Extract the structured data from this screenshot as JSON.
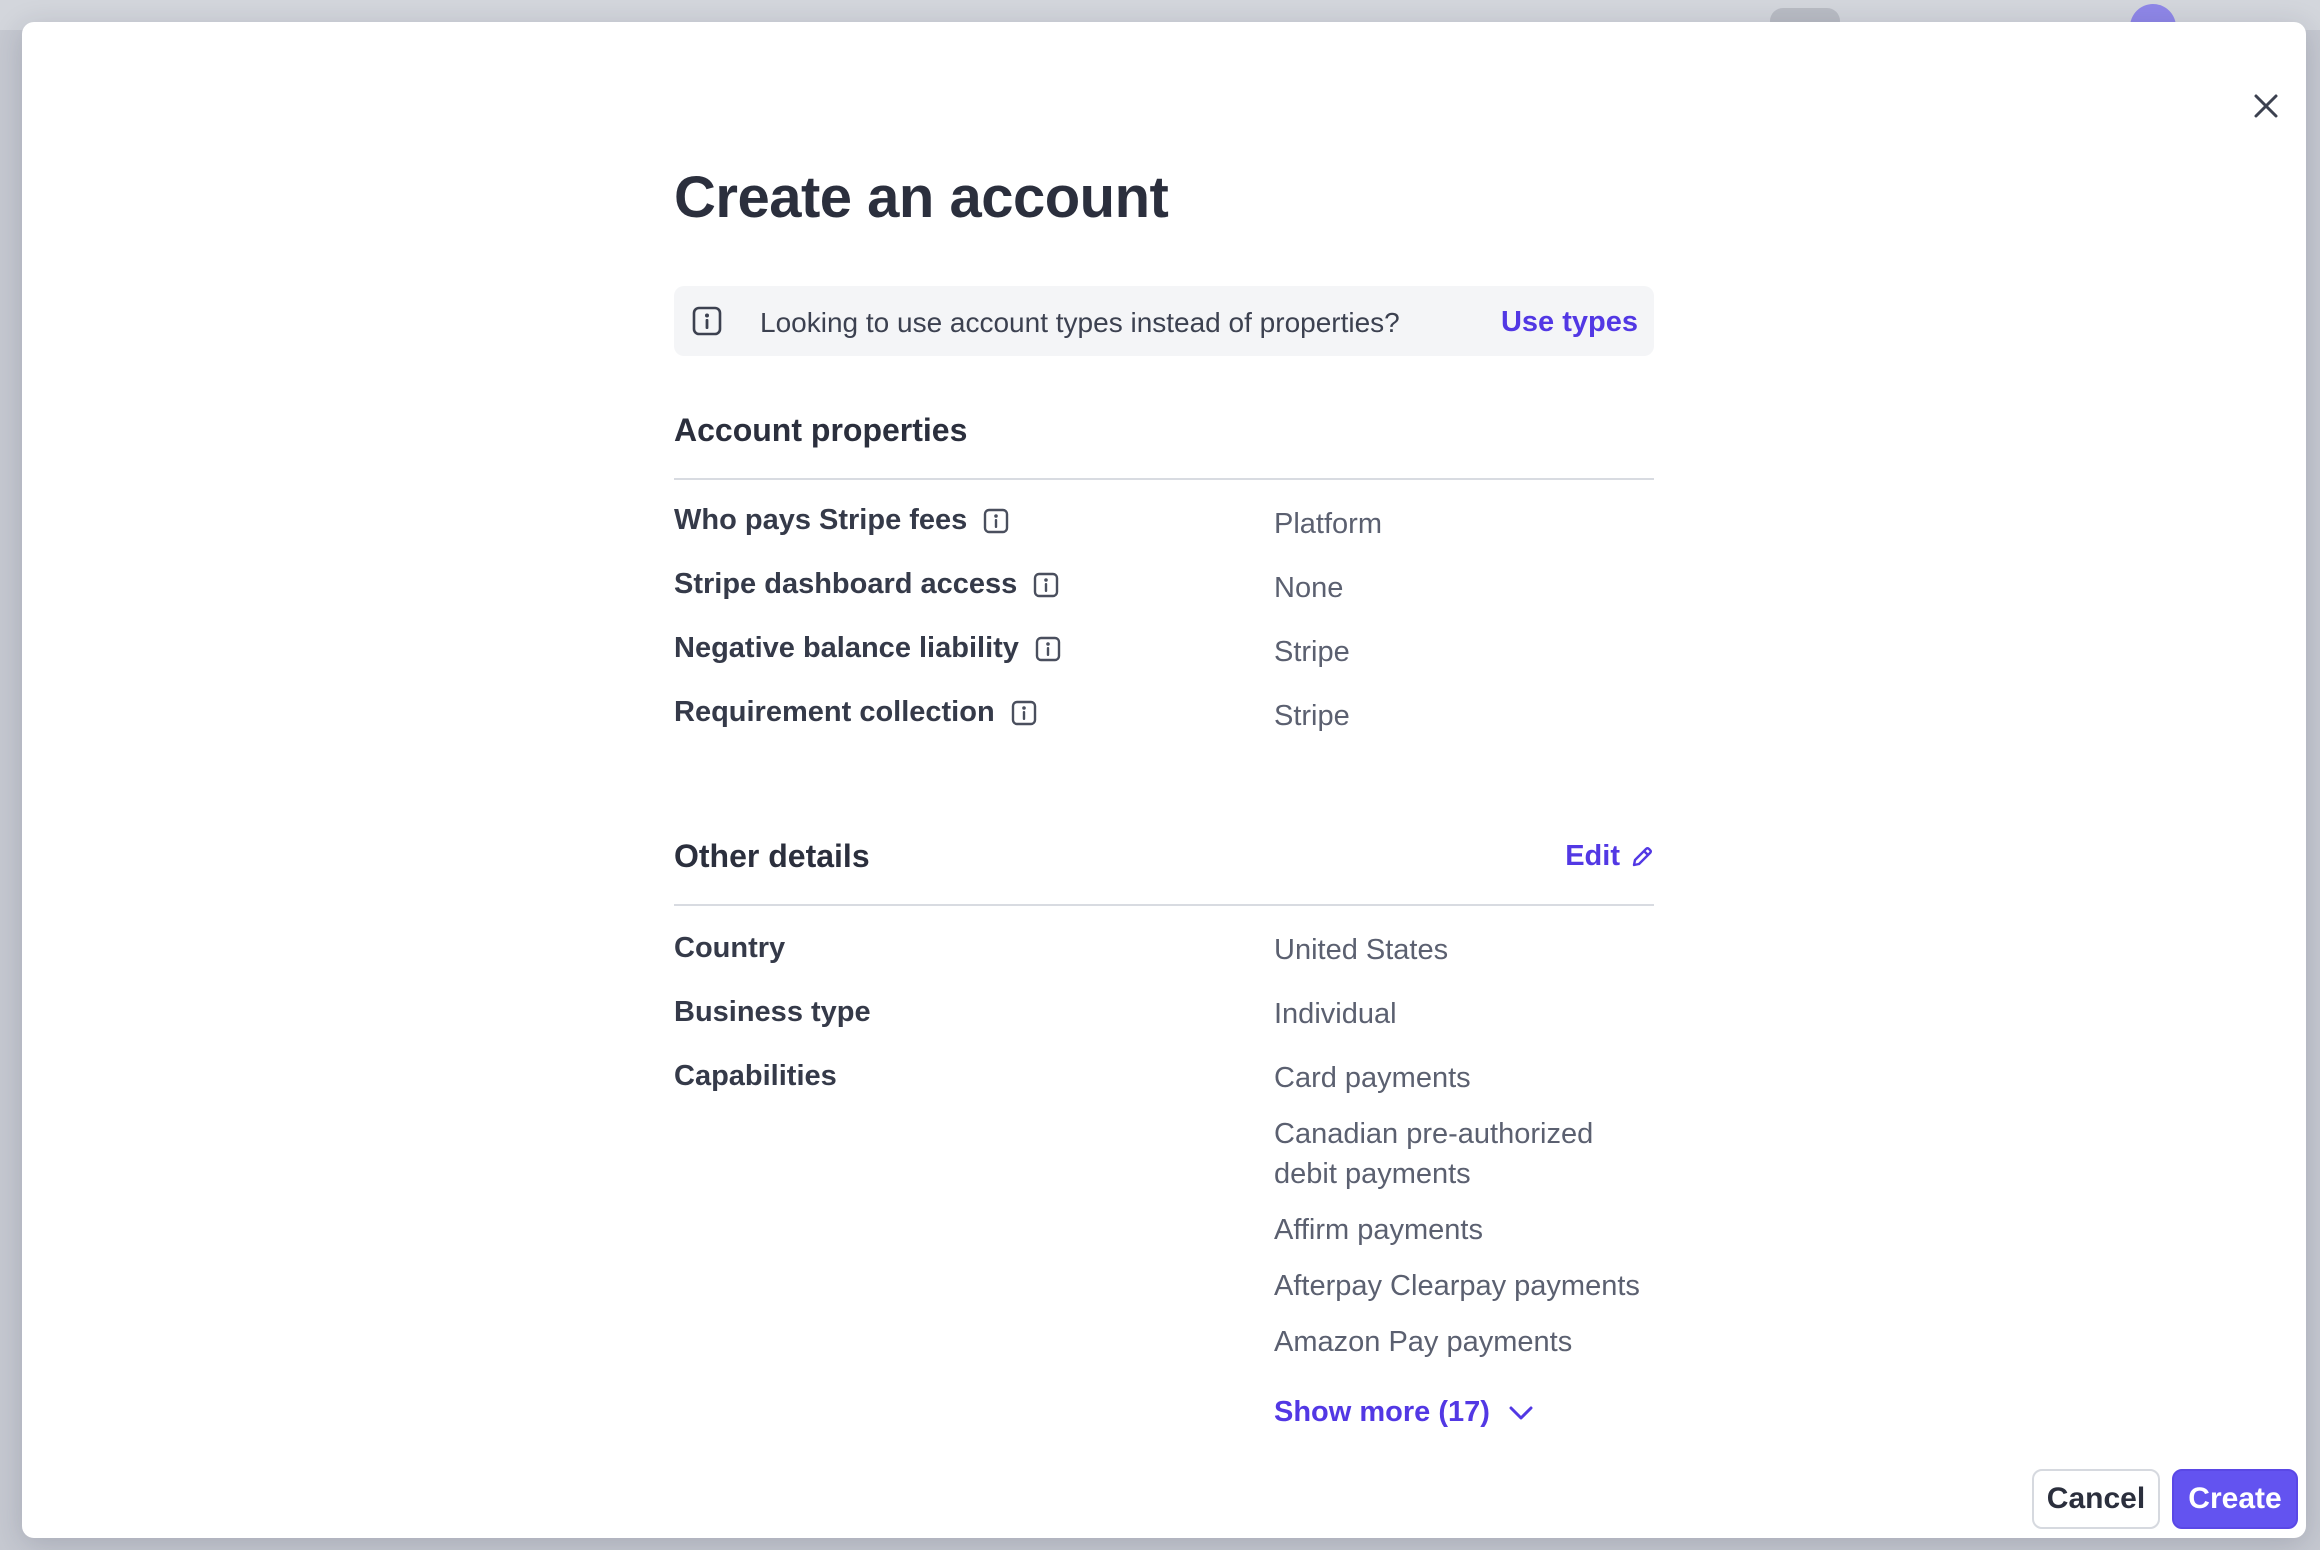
{
  "modal": {
    "title": "Create an account",
    "close_icon": "close-icon"
  },
  "banner": {
    "icon": "info-icon",
    "text": "Looking to use account types instead of properties?",
    "link_label": "Use types"
  },
  "account_properties": {
    "heading": "Account properties",
    "rows": [
      {
        "label": "Who pays Stripe fees",
        "value": "Platform"
      },
      {
        "label": "Stripe dashboard access",
        "value": "None"
      },
      {
        "label": "Negative balance liability",
        "value": "Stripe"
      },
      {
        "label": "Requirement collection",
        "value": "Stripe"
      }
    ]
  },
  "other_details": {
    "heading": "Other details",
    "edit_label": "Edit",
    "country_label": "Country",
    "country_value": "United States",
    "business_type_label": "Business type",
    "business_type_value": "Individual",
    "capabilities_label": "Capabilities",
    "capabilities": [
      "Card payments",
      "Canadian pre-authorized",
      "debit payments",
      "Affirm payments",
      "Afterpay Clearpay payments",
      "Amazon Pay payments"
    ],
    "show_more_label": "Show more (17)"
  },
  "footer": {
    "cancel_label": "Cancel",
    "create_label": "Create"
  },
  "colors": {
    "accent": "#5238e4",
    "primary_button": "#6353f0",
    "text_dark": "#2b2f3d",
    "text_muted": "#5b6070"
  }
}
